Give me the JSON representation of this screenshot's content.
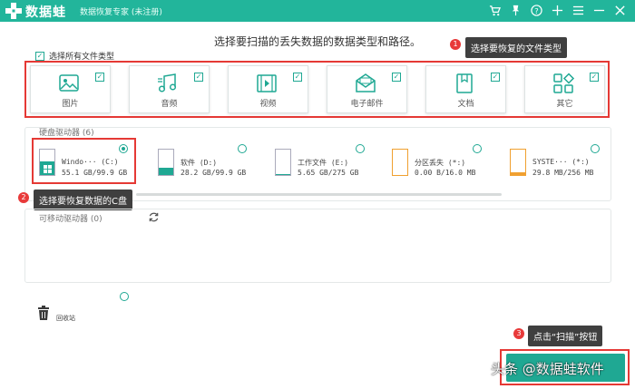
{
  "app": {
    "name": "数据蛙",
    "subtitle": "数据恢复专家 (未注册)"
  },
  "titlebar_icons": [
    "cart-icon",
    "pin-icon",
    "help-icon",
    "plus-icon",
    "menu-icon",
    "minimize-icon",
    "close-icon"
  ],
  "prompt": "选择要扫描的丢失数据的数据类型和路径。",
  "callouts": {
    "types": {
      "number": "1",
      "text": "选择要恢复的文件类型"
    },
    "drive": {
      "number": "2",
      "text": "选择要恢复数据的C盘"
    },
    "scan": {
      "number": "3",
      "text": "点击“扫描”按钮"
    }
  },
  "select_all": {
    "label": "选择所有文件类型",
    "checked": true
  },
  "file_types": [
    {
      "label": "图片",
      "icon": "image-icon",
      "checked": true
    },
    {
      "label": "音频",
      "icon": "music-icon",
      "checked": true
    },
    {
      "label": "视频",
      "icon": "video-icon",
      "checked": true
    },
    {
      "label": "电子邮件",
      "icon": "email-icon",
      "checked": true
    },
    {
      "label": "文档",
      "icon": "document-icon",
      "checked": true
    },
    {
      "label": "其它",
      "icon": "other-icon",
      "checked": true
    }
  ],
  "hard_drives": {
    "title": "硬盘驱动器 (6)",
    "items": [
      {
        "name": "Windo··· (C:)",
        "size": "55.1 GB/99.9 GB",
        "selected": true,
        "fill_fraction": 0.55,
        "fill_color": "#1fa893"
      },
      {
        "name": "软件 (D:)",
        "size": "28.2 GB/99.9 GB",
        "selected": false,
        "fill_fraction": 0.28,
        "fill_color": "#1fa893"
      },
      {
        "name": "工作文件 (E:)",
        "size": "5.65 GB/275 GB",
        "selected": false,
        "fill_fraction": 0.02,
        "fill_color": "#1fa893"
      },
      {
        "name": "分区丢失 (*:)",
        "size": "0.00  B/16.0 MB",
        "selected": false,
        "fill_fraction": 0.0,
        "fill_color": "#f0a030"
      },
      {
        "name": "SYSTE··· (*:)",
        "size": "29.8 MB/256 MB",
        "selected": false,
        "fill_fraction": 0.12,
        "fill_color": "#f0a030"
      }
    ]
  },
  "removable_drives": {
    "title": "可移动驱动器 (0)"
  },
  "recycle": {
    "label": "回收站"
  },
  "watermark": "头条 @数据蛙软件"
}
